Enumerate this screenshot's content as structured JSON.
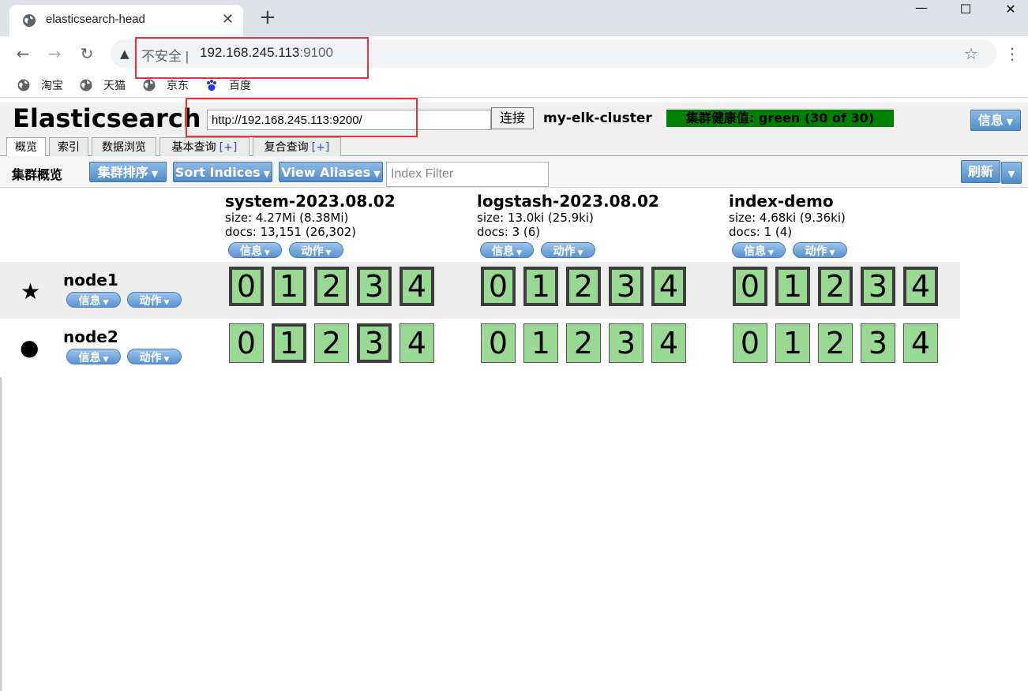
{
  "browser": {
    "tab_title": "elasticsearch-head",
    "tab_close": "✕",
    "new_tab": "+",
    "window_controls": [
      "—",
      "☐",
      "✕"
    ],
    "nav": {
      "back": "←",
      "forward": "→",
      "reload": "↻"
    },
    "insecure_label": "不安全 |",
    "url_host": "192.168.245.113",
    "url_port": ":9100",
    "star": "☆",
    "menu": "⋮",
    "bookmarks": [
      {
        "label": "淘宝",
        "icon": "globe-icon"
      },
      {
        "label": "天猫",
        "icon": "globe-icon"
      },
      {
        "label": "京东",
        "icon": "globe-icon"
      },
      {
        "label": "百度",
        "icon": "paw-icon"
      }
    ]
  },
  "app": {
    "title": "Elasticsearch",
    "cluster_url": "http://192.168.245.113:9200/",
    "connect_label": "连接",
    "cluster_name": "my-elk-cluster",
    "cluster_health": "集群健康值: green (30 of 30)",
    "info_label": "信息",
    "tabs": [
      {
        "label": "概览",
        "plus": ""
      },
      {
        "label": "索引",
        "plus": ""
      },
      {
        "label": "数据浏览",
        "plus": ""
      },
      {
        "label": "基本查询",
        "plus": "[+]"
      },
      {
        "label": "复合查询",
        "plus": "[+]"
      }
    ],
    "overview_label": "集群概览",
    "cluster_sort_label": "集群排序",
    "sort_indices_label": "Sort Indices",
    "view_aliases_label": "View Aliases",
    "index_filter_placeholder": "Index Filter",
    "refresh_label": "刷新"
  },
  "pill_labels": {
    "info": "信息",
    "action": "动作"
  },
  "indices": [
    {
      "name": "system-2023.08.02",
      "size": "size: 4.27Mi (8.38Mi)",
      "docs": "docs: 13,151 (26,302)"
    },
    {
      "name": "logstash-2023.08.02",
      "size": "size: 13.0ki (25.9ki)",
      "docs": "docs: 3 (6)"
    },
    {
      "name": "index-demo",
      "size": "size: 4.68ki (9.36ki)",
      "docs": "docs: 1 (4)"
    }
  ],
  "nodes": [
    {
      "name": "node1",
      "icon": "★",
      "primaries": [
        [
          0,
          1,
          2,
          3,
          4
        ],
        [
          0,
          1,
          2,
          3,
          4
        ],
        [
          0,
          1,
          2,
          3,
          4
        ]
      ]
    },
    {
      "name": "node2",
      "icon": "●",
      "primaries": [
        [
          1,
          3
        ],
        [],
        []
      ]
    }
  ],
  "shard_labels": [
    "0",
    "1",
    "2",
    "3",
    "4"
  ],
  "colors": {
    "shard": "#99d993",
    "health": "#008000",
    "button": "#4f8cc9",
    "highlight": "#e8333a"
  }
}
